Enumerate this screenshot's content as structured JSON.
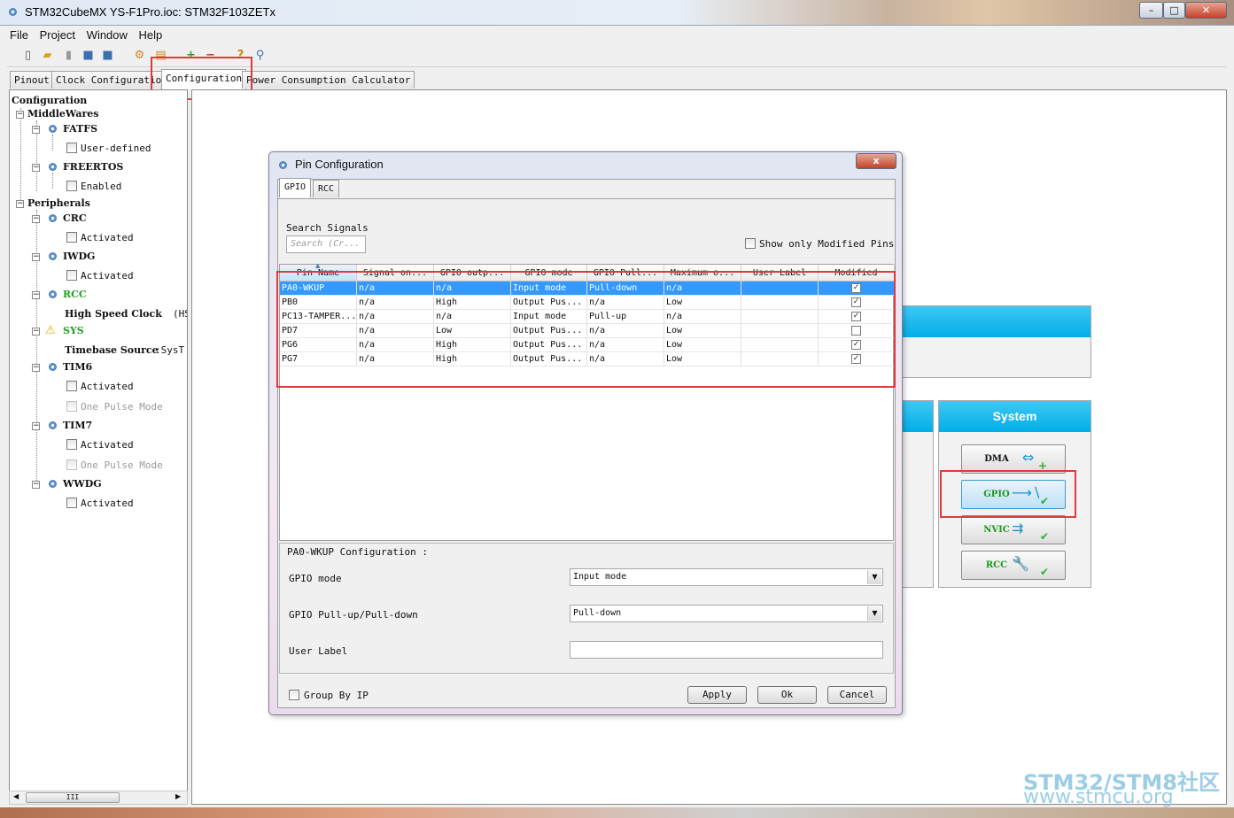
{
  "window": {
    "title": "STM32CubeMX YS-F1Pro.ioc: STM32F103ZETx"
  },
  "menu": [
    "File",
    "Project",
    "Window",
    "Help"
  ],
  "tabs": [
    {
      "label": "Pinout"
    },
    {
      "label": "Clock Configuration"
    },
    {
      "label": "Configuration"
    },
    {
      "label": "Power Consumption Calculator"
    }
  ],
  "tree": {
    "root": "Configuration",
    "middlewares": "MiddleWares",
    "fatfs": "FATFS",
    "fatfs_opt": "User-defined",
    "freertos": "FREERTOS",
    "freertos_opt": "Enabled",
    "peripherals": "Peripherals",
    "crc": "CRC",
    "crc_opt": "Activated",
    "iwdg": "IWDG",
    "iwdg_opt": "Activated",
    "rcc": "RCC",
    "rcc_hse_label": "High Speed Clock",
    "rcc_hse_value": "(HS",
    "sys": "SYS",
    "sys_tb_label": "Timebase Source",
    "sys_tb_value": ":SysT",
    "tim6": "TIM6",
    "tim6_opt1": "Activated",
    "tim6_opt2": "One Pulse Mode",
    "tim7": "TIM7",
    "tim7_opt1": "Activated",
    "tim7_opt2": "One Pulse Mode",
    "wwdg": "WWDG",
    "wwdg_opt": "Activated",
    "hscroll_thumb": "III"
  },
  "system_panel": {
    "header": "System",
    "dma": "DMA",
    "gpio": "GPIO",
    "nvic": "NVIC",
    "rcc": "RCC"
  },
  "dialog": {
    "title": "Pin Configuration",
    "close": "x",
    "tabs": [
      "GPIO",
      "RCC"
    ],
    "search_label": "Search Signals",
    "search_placeholder": "Search (Cr...",
    "show_modified": "Show only Modified Pins",
    "columns": [
      "Pin Name",
      "Signal on...",
      "GPIO outp...",
      "GPIO mode",
      "GPIO Pull...",
      "Maximum o...",
      "User Label",
      "Modified"
    ],
    "rows": [
      {
        "pin": "PA0-WKUP",
        "signal": "n/a",
        "output": "n/a",
        "mode": "Input mode",
        "pull": "Pull-down",
        "max": "n/a",
        "label": "",
        "modified": true
      },
      {
        "pin": "PB0",
        "signal": "n/a",
        "output": "High",
        "mode": "Output Pus...",
        "pull": "n/a",
        "max": "Low",
        "label": "",
        "modified": true
      },
      {
        "pin": "PC13-TAMPER...",
        "signal": "n/a",
        "output": "n/a",
        "mode": "Input mode",
        "pull": "Pull-up",
        "max": "n/a",
        "label": "",
        "modified": true
      },
      {
        "pin": "PD7",
        "signal": "n/a",
        "output": "Low",
        "mode": "Output Pus...",
        "pull": "n/a",
        "max": "Low",
        "label": "",
        "modified": false
      },
      {
        "pin": "PG6",
        "signal": "n/a",
        "output": "High",
        "mode": "Output Pus...",
        "pull": "n/a",
        "max": "Low",
        "label": "",
        "modified": true
      },
      {
        "pin": "PG7",
        "signal": "n/a",
        "output": "High",
        "mode": "Output Pus...",
        "pull": "n/a",
        "max": "Low",
        "label": "",
        "modified": true
      }
    ],
    "config_title": "PA0-WKUP Configuration :",
    "gpio_mode_label": "GPIO mode",
    "gpio_mode_value": "Input mode",
    "pull_label": "GPIO Pull-up/Pull-down",
    "pull_value": "Pull-down",
    "user_label_label": "User Label",
    "user_label_value": "",
    "group_by_ip": "Group By IP",
    "apply": "Apply",
    "ok": "Ok",
    "cancel": "Cancel"
  },
  "watermark": {
    "line1": "STM32/STM8社区",
    "line2": "www.stmcu.org"
  },
  "colors": {
    "accent": "#00aee8",
    "selection": "#3399ff",
    "highlight_box": "#e03a3a",
    "rcc_sys_green": "#1ea01e"
  }
}
